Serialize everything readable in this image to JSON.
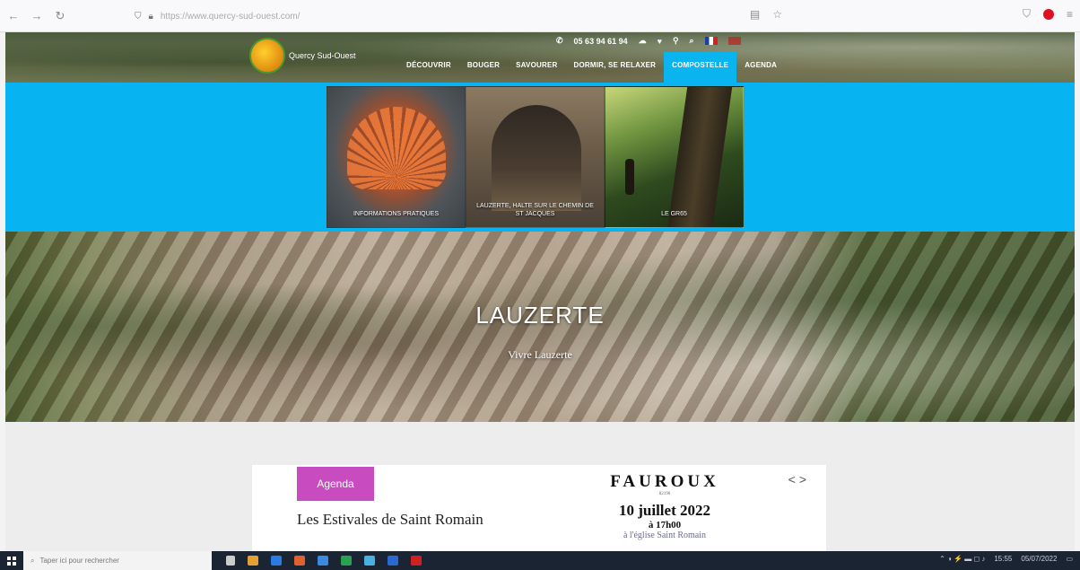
{
  "browser": {
    "url": "https://www.quercy-sud-ouest.com/"
  },
  "site": {
    "logo_text": "Quercy Sud-Ouest",
    "phone": "05 63 94 61 94",
    "nav": [
      {
        "label": "DÉCOUVRIR"
      },
      {
        "label": "BOUGER"
      },
      {
        "label": "SAVOURER"
      },
      {
        "label": "DORMIR, SE RELAXER"
      },
      {
        "label": "COMPOSTELLE"
      },
      {
        "label": "AGENDA"
      }
    ]
  },
  "mega_menu": {
    "tiles": [
      {
        "label": "INFORMATIONS PRATIQUES"
      },
      {
        "label": "LAUZERTE, HALTE SUR LE CHEMIN DE ST JACQUES"
      },
      {
        "label": "LE GR65"
      }
    ]
  },
  "hero": {
    "title": "LAUZERTE",
    "subtitle": "Vivre Lauzerte"
  },
  "agenda": {
    "badge": "Agenda",
    "event_title": "Les Estivales de Saint Romain",
    "poster_name": "FAUROUX",
    "poster_small": "82190",
    "poster_date": "10 juillet 2022",
    "poster_time": "à 17h00",
    "poster_venue": "à l'église Saint Romain",
    "arrows": "<>"
  },
  "taskbar": {
    "search_placeholder": "Taper ici pour rechercher",
    "time": "15:55",
    "date": "05/07/2022"
  }
}
